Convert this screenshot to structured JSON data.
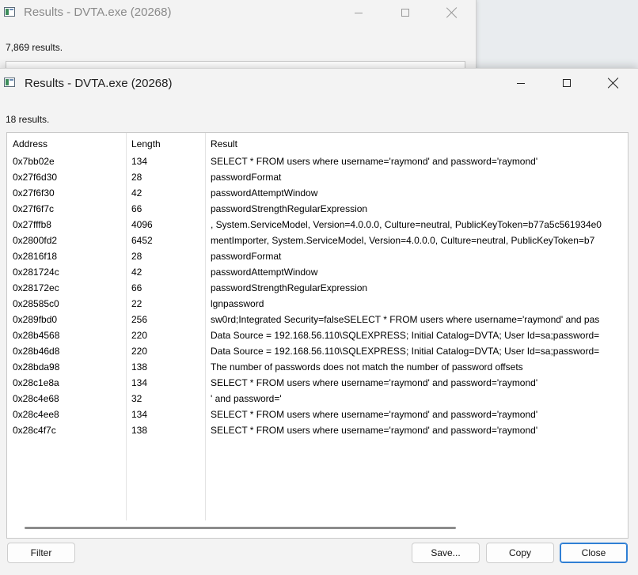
{
  "back_window": {
    "title": "Results - DVTA.exe (20268)",
    "result_count": "7,869 results."
  },
  "front_window": {
    "title": "Results - DVTA.exe (20268)",
    "result_count": "18 results.",
    "columns": [
      "Address",
      "Length",
      "Result"
    ],
    "rows": [
      {
        "address": "0x7bb02e",
        "length": "134",
        "result": "SELECT * FROM users where username='raymond' and password='raymond'"
      },
      {
        "address": "0x27f6d30",
        "length": "28",
        "result": "passwordFormat"
      },
      {
        "address": "0x27f6f30",
        "length": "42",
        "result": "passwordAttemptWindow"
      },
      {
        "address": "0x27f6f7c",
        "length": "66",
        "result": "passwordStrengthRegularExpression"
      },
      {
        "address": "0x27fffb8",
        "length": "4096",
        "result": ", System.ServiceModel, Version=4.0.0.0, Culture=neutral, PublicKeyToken=b77a5c561934e0"
      },
      {
        "address": "0x2800fd2",
        "length": "6452",
        "result": "mentImporter, System.ServiceModel, Version=4.0.0.0, Culture=neutral, PublicKeyToken=b7"
      },
      {
        "address": "0x2816f18",
        "length": "28",
        "result": "passwordFormat"
      },
      {
        "address": "0x281724c",
        "length": "42",
        "result": "passwordAttemptWindow"
      },
      {
        "address": "0x28172ec",
        "length": "66",
        "result": "passwordStrengthRegularExpression"
      },
      {
        "address": "0x28585c0",
        "length": "22",
        "result": "lgnpassword"
      },
      {
        "address": "0x289fbd0",
        "length": "256",
        "result": "sw0rd;Integrated Security=falseSELECT * FROM users where username='raymond' and pas"
      },
      {
        "address": "0x28b4568",
        "length": "220",
        "result": "Data Source = 192.168.56.110\\SQLEXPRESS; Initial Catalog=DVTA; User Id=sa;password="
      },
      {
        "address": "0x28b46d8",
        "length": "220",
        "result": "Data Source = 192.168.56.110\\SQLEXPRESS; Initial Catalog=DVTA; User Id=sa;password="
      },
      {
        "address": "0x28bda98",
        "length": "138",
        "result": "The number of passwords does not match the number of password offsets"
      },
      {
        "address": "0x28c1e8a",
        "length": "134",
        "result": "SELECT * FROM users where username='raymond' and password='raymond'"
      },
      {
        "address": "0x28c4e68",
        "length": "32",
        "result": "' and password='"
      },
      {
        "address": "0x28c4ee8",
        "length": "134",
        "result": "SELECT * FROM users where username='raymond' and password='raymond'"
      },
      {
        "address": "0x28c4f7c",
        "length": "138",
        "result": "SELECT * FROM users where username='raymond' and password='raymond'"
      }
    ],
    "buttons": {
      "filter": "Filter",
      "save": "Save...",
      "copy": "Copy",
      "close": "Close"
    }
  },
  "icons": {
    "app": "app-window-icon",
    "minimize": "minimize-icon",
    "maximize": "maximize-icon",
    "close": "close-icon"
  }
}
